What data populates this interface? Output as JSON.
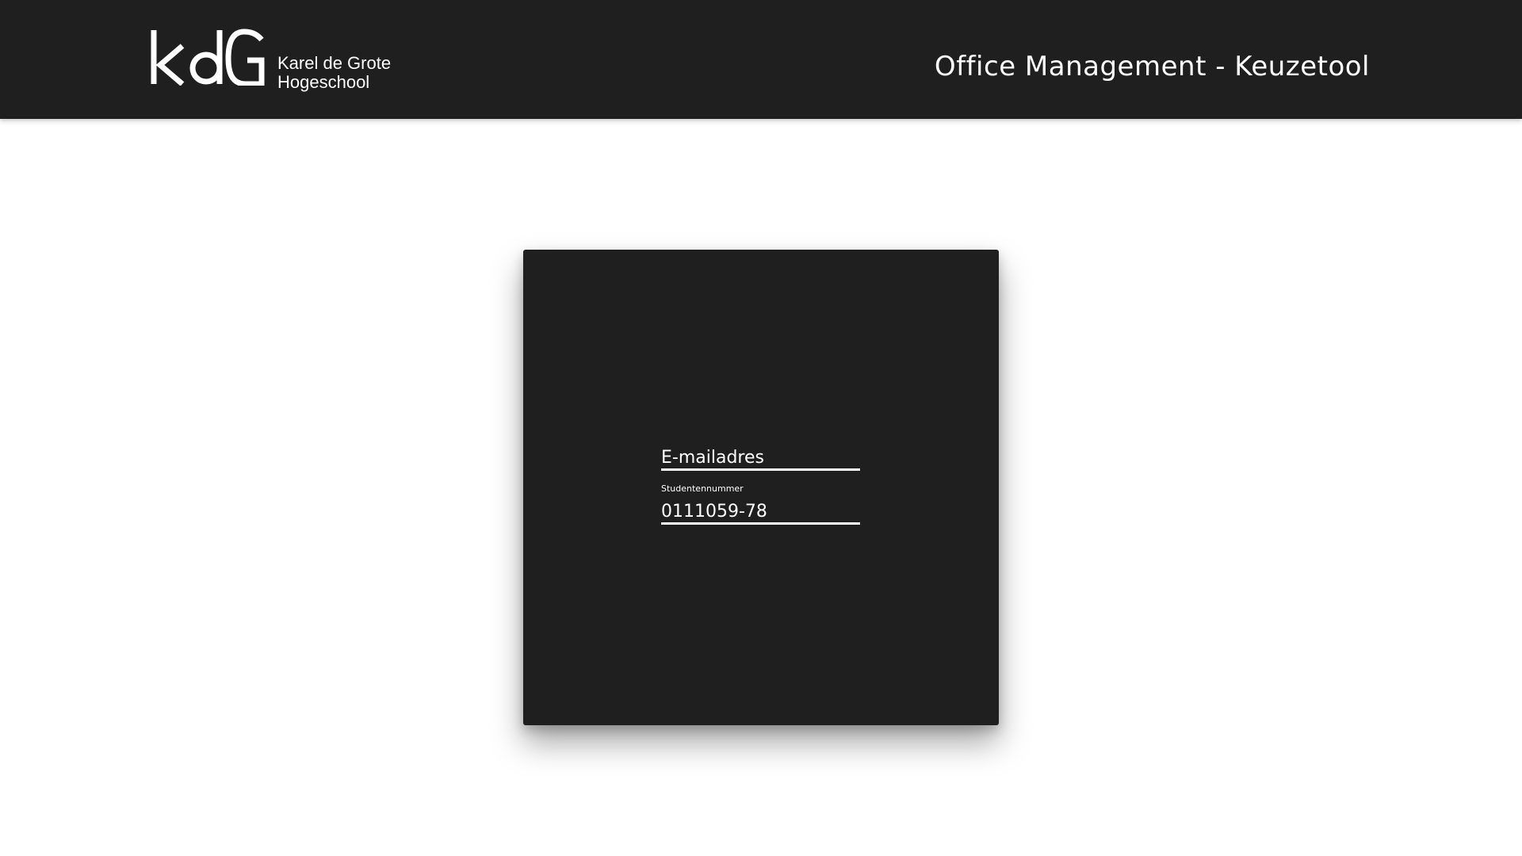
{
  "header": {
    "logo": {
      "mark": "KdG",
      "line1": "Karel de Grote",
      "line2": "Hogeschool"
    },
    "title": "Office Management - Keuzetool"
  },
  "login_form": {
    "email": {
      "placeholder": "E-mailadres",
      "value": ""
    },
    "student_number": {
      "label": "Studentennummer",
      "value": "0111059-78"
    }
  },
  "colors": {
    "header_bg": "#1f1f1f",
    "card_bg": "#1f1f1f",
    "text": "#ffffff",
    "page_bg": "#ffffff"
  }
}
